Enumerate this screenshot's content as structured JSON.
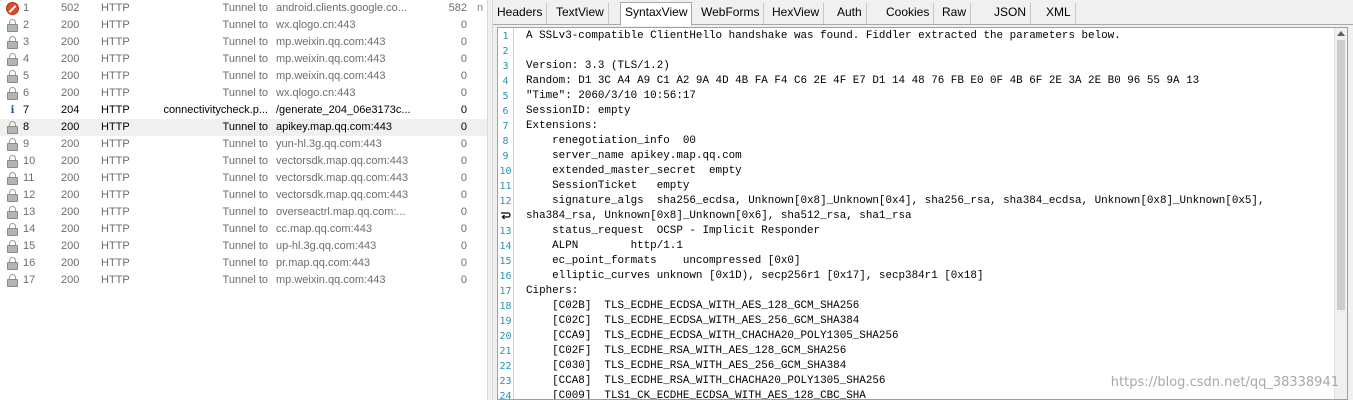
{
  "sessions": [
    {
      "num": "1",
      "icon": "error-icon",
      "result": "502",
      "protocol": "HTTP",
      "host": "Tunnel to",
      "url": "android.clients.google.co...",
      "body": "582",
      "extra": "n",
      "bold": false,
      "selected": false
    },
    {
      "num": "2",
      "icon": "lock-icon",
      "result": "200",
      "protocol": "HTTP",
      "host": "Tunnel to",
      "url": "wx.qlogo.cn:443",
      "body": "0",
      "extra": "",
      "bold": false,
      "selected": false
    },
    {
      "num": "3",
      "icon": "lock-icon",
      "result": "200",
      "protocol": "HTTP",
      "host": "Tunnel to",
      "url": "mp.weixin.qq.com:443",
      "body": "0",
      "extra": "",
      "bold": false,
      "selected": false
    },
    {
      "num": "4",
      "icon": "lock-icon",
      "result": "200",
      "protocol": "HTTP",
      "host": "Tunnel to",
      "url": "mp.weixin.qq.com:443",
      "body": "0",
      "extra": "",
      "bold": false,
      "selected": false
    },
    {
      "num": "5",
      "icon": "lock-icon",
      "result": "200",
      "protocol": "HTTP",
      "host": "Tunnel to",
      "url": "mp.weixin.qq.com:443",
      "body": "0",
      "extra": "",
      "bold": false,
      "selected": false
    },
    {
      "num": "6",
      "icon": "lock-icon",
      "result": "200",
      "protocol": "HTTP",
      "host": "Tunnel to",
      "url": "wx.qlogo.cn:443",
      "body": "0",
      "extra": "",
      "bold": false,
      "selected": false
    },
    {
      "num": "7",
      "icon": "info-icon",
      "result": "204",
      "protocol": "HTTP",
      "host": "connectivitycheck.p...",
      "url": "/generate_204_06e3173c...",
      "body": "0",
      "extra": "",
      "bold": true,
      "selected": false
    },
    {
      "num": "8",
      "icon": "lock-icon",
      "result": "200",
      "protocol": "HTTP",
      "host": "Tunnel to",
      "url": "apikey.map.qq.com:443",
      "body": "0",
      "extra": "",
      "bold": true,
      "selected": true
    },
    {
      "num": "9",
      "icon": "lock-icon",
      "result": "200",
      "protocol": "HTTP",
      "host": "Tunnel to",
      "url": "yun-hl.3g.qq.com:443",
      "body": "0",
      "extra": "",
      "bold": false,
      "selected": false
    },
    {
      "num": "10",
      "icon": "lock-icon",
      "result": "200",
      "protocol": "HTTP",
      "host": "Tunnel to",
      "url": "vectorsdk.map.qq.com:443",
      "body": "0",
      "extra": "",
      "bold": false,
      "selected": false
    },
    {
      "num": "11",
      "icon": "lock-icon",
      "result": "200",
      "protocol": "HTTP",
      "host": "Tunnel to",
      "url": "vectorsdk.map.qq.com:443",
      "body": "0",
      "extra": "",
      "bold": false,
      "selected": false
    },
    {
      "num": "12",
      "icon": "lock-icon",
      "result": "200",
      "protocol": "HTTP",
      "host": "Tunnel to",
      "url": "vectorsdk.map.qq.com:443",
      "body": "0",
      "extra": "",
      "bold": false,
      "selected": false
    },
    {
      "num": "13",
      "icon": "lock-icon",
      "result": "200",
      "protocol": "HTTP",
      "host": "Tunnel to",
      "url": "overseactrl.map.qq.com:...",
      "body": "0",
      "extra": "",
      "bold": false,
      "selected": false
    },
    {
      "num": "14",
      "icon": "lock-icon",
      "result": "200",
      "protocol": "HTTP",
      "host": "Tunnel to",
      "url": "cc.map.qq.com:443",
      "body": "0",
      "extra": "",
      "bold": false,
      "selected": false
    },
    {
      "num": "15",
      "icon": "lock-icon",
      "result": "200",
      "protocol": "HTTP",
      "host": "Tunnel to",
      "url": "up-hl.3g.qq.com:443",
      "body": "0",
      "extra": "",
      "bold": false,
      "selected": false
    },
    {
      "num": "16",
      "icon": "lock-icon",
      "result": "200",
      "protocol": "HTTP",
      "host": "Tunnel to",
      "url": "pr.map.qq.com:443",
      "body": "0",
      "extra": "",
      "bold": false,
      "selected": false
    },
    {
      "num": "17",
      "icon": "lock-icon",
      "result": "200",
      "protocol": "HTTP",
      "host": "Tunnel to",
      "url": "mp.weixin.qq.com:443",
      "body": "0",
      "extra": "",
      "bold": false,
      "selected": false
    }
  ],
  "tabs": [
    {
      "label": "Headers",
      "active": false
    },
    {
      "label": "TextView",
      "active": false
    },
    {
      "label": "SyntaxView",
      "active": true
    },
    {
      "label": "WebForms",
      "active": false
    },
    {
      "label": "HexView",
      "active": false
    },
    {
      "label": "Auth",
      "active": false
    },
    {
      "label": "Cookies",
      "active": false
    },
    {
      "label": "Raw",
      "active": false
    },
    {
      "label": "JSON",
      "active": false
    },
    {
      "label": "XML",
      "active": false
    }
  ],
  "code_lines": [
    {
      "n": "1",
      "text": "A SSLv3-compatible ClientHello handshake was found. Fiddler extracted the parameters below."
    },
    {
      "n": "2",
      "text": ""
    },
    {
      "n": "3",
      "text": "Version: 3.3 (TLS/1.2)"
    },
    {
      "n": "4",
      "text": "Random: D1 3C A4 A9 C1 A2 9A 4D 4B FA F4 C6 2E 4F E7 D1 14 48 76 FB E0 0F 4B 6F 2E 3A 2E B0 96 55 9A 13"
    },
    {
      "n": "5",
      "text": "\"Time\": 2060/3/10 10:56:17"
    },
    {
      "n": "6",
      "text": "SessionID: empty"
    },
    {
      "n": "7",
      "text": "Extensions:"
    },
    {
      "n": "8",
      "text": "    renegotiation_info  00"
    },
    {
      "n": "9",
      "text": "    server_name apikey.map.qq.com"
    },
    {
      "n": "10",
      "text": "    extended_master_secret  empty"
    },
    {
      "n": "11",
      "text": "    SessionTicket   empty"
    },
    {
      "n": "12",
      "text": "    signature_algs  sha256_ecdsa, Unknown[0x8]_Unknown[0x4], sha256_rsa, sha384_ecdsa, Unknown[0x8]_Unknown[0x5],"
    },
    {
      "n": "",
      "wrap": true,
      "text": "sha384_rsa, Unknown[0x8]_Unknown[0x6], sha512_rsa, sha1_rsa"
    },
    {
      "n": "13",
      "text": "    status_request  OCSP - Implicit Responder"
    },
    {
      "n": "14",
      "text": "    ALPN        http/1.1"
    },
    {
      "n": "15",
      "text": "    ec_point_formats    uncompressed [0x0]"
    },
    {
      "n": "16",
      "text": "    elliptic_curves unknown [0x1D), secp256r1 [0x17], secp384r1 [0x18]"
    },
    {
      "n": "17",
      "text": "Ciphers:"
    },
    {
      "n": "18",
      "text": "    [C02B]  TLS_ECDHE_ECDSA_WITH_AES_128_GCM_SHA256"
    },
    {
      "n": "19",
      "text": "    [C02C]  TLS_ECDHE_ECDSA_WITH_AES_256_GCM_SHA384"
    },
    {
      "n": "20",
      "text": "    [CCA9]  TLS_ECDHE_ECDSA_WITH_CHACHA20_POLY1305_SHA256"
    },
    {
      "n": "21",
      "text": "    [C02F]  TLS_ECDHE_RSA_WITH_AES_128_GCM_SHA256"
    },
    {
      "n": "22",
      "text": "    [C030]  TLS_ECDHE_RSA_WITH_AES_256_GCM_SHA384"
    },
    {
      "n": "23",
      "text": "    [CCA8]  TLS_ECDHE_RSA_WITH_CHACHA20_POLY1305_SHA256"
    },
    {
      "n": "24",
      "text": "    [C009]  TLS1_CK_ECDHE_ECDSA_WITH_AES_128_CBC_SHA"
    }
  ],
  "watermark": "https://blog.csdn.net/qq_38338941",
  "colors": {
    "line_number": "#2b91af",
    "selected_row": "#f0f0f0",
    "error_icon": "#e0492c",
    "info_icon": "#1d4fa8"
  }
}
